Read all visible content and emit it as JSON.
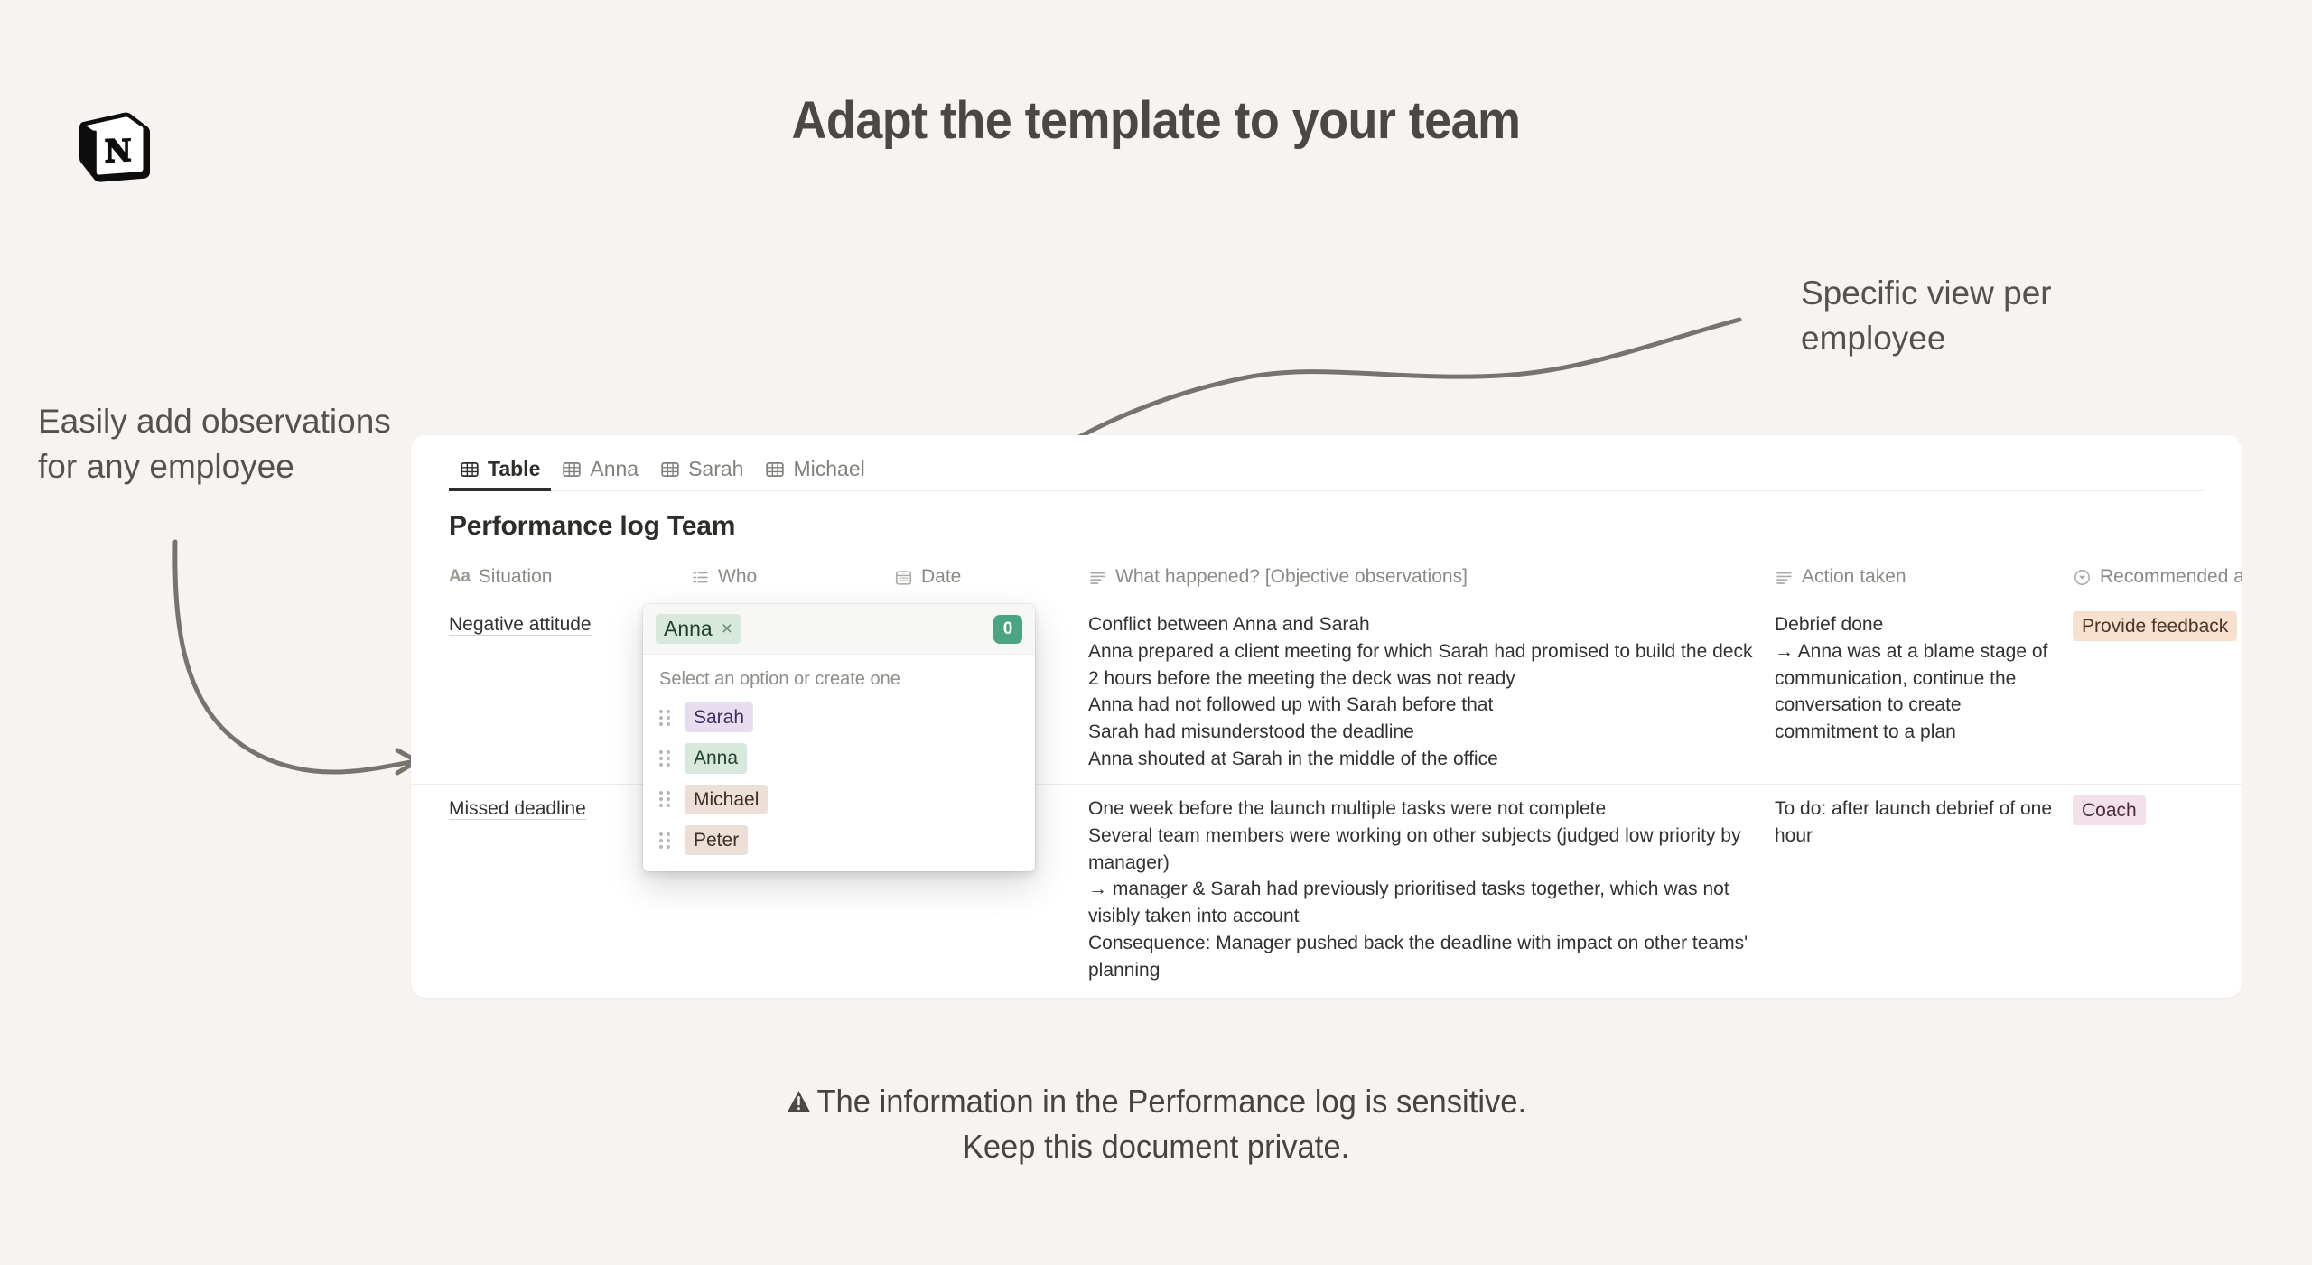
{
  "page": {
    "headline": "Adapt the template to your team",
    "background_color": "#f7f3f0",
    "logo_name": "notion-logo"
  },
  "annotations": {
    "left": "Easily add observations for any employee",
    "right": "Specific view per employee"
  },
  "caption": {
    "line1": "The information in the Performance log is sensitive.",
    "line2": "Keep this document private.",
    "icon": "warning-icon"
  },
  "app": {
    "tabs": [
      {
        "label": "Table",
        "icon": "table-icon",
        "active": true
      },
      {
        "label": "Anna",
        "icon": "table-icon",
        "active": false
      },
      {
        "label": "Sarah",
        "icon": "table-icon",
        "active": false
      },
      {
        "label": "Michael",
        "icon": "table-icon",
        "active": false
      }
    ],
    "database_title": "Performance log Team",
    "columns": [
      {
        "label": "Situation",
        "icon": "title-text-icon"
      },
      {
        "label": "Who",
        "icon": "multi-select-icon"
      },
      {
        "label": "Date",
        "icon": "calendar-icon"
      },
      {
        "label": "What happened? [Objective observations]",
        "icon": "text-lines-icon"
      },
      {
        "label": "Action taken",
        "icon": "text-lines-icon"
      },
      {
        "label": "Recommended action",
        "icon": "select-circle-icon"
      }
    ],
    "toolbar": {
      "add_property_label": "+",
      "more_options_label": "···"
    },
    "rows": [
      {
        "situation": "Negative attitude",
        "who": "Anna",
        "date": "",
        "what_happened": "Conflict between Anna and Sarah\nAnna prepared a client meeting for which Sarah had promised to build the deck\n2 hours before the meeting the deck was not ready\nAnna had not followed up with Sarah before that\nSarah had misunderstood the deadline\nAnna shouted at Sarah in the middle of the office",
        "action_taken": "Debrief done\n→ Anna was at a blame stage of communication, continue the conversation to create commitment to a plan",
        "recommended_action": "Provide feedback",
        "recommended_action_color": "#f8e0ce"
      },
      {
        "situation": "Missed deadline",
        "who": "",
        "date": "",
        "what_happened": "One week before the launch multiple tasks were not complete\nSeveral team members were working on other subjects (judged low priority by manager)\n→ manager & Sarah had previously prioritised tasks together, which was not visibly taken into account\nConsequence: Manager pushed back the deadline with impact on other teams' planning",
        "action_taken": "To do: after launch debrief of one hour",
        "recommended_action": "Coach",
        "recommended_action_color": "#f4e0ea"
      }
    ]
  },
  "popup": {
    "selected_chip": "Anna",
    "remove_chip_label": "×",
    "collaborator_badge": "0",
    "collaborator_badge_color": "#4aa580",
    "hint": "Select an option or create one",
    "options": [
      {
        "label": "Sarah",
        "color": "#e6deef"
      },
      {
        "label": "Anna",
        "color": "#d7e9dc"
      },
      {
        "label": "Michael",
        "color": "#ecdfd8"
      },
      {
        "label": "Peter",
        "color": "#ecdfd8"
      }
    ]
  }
}
